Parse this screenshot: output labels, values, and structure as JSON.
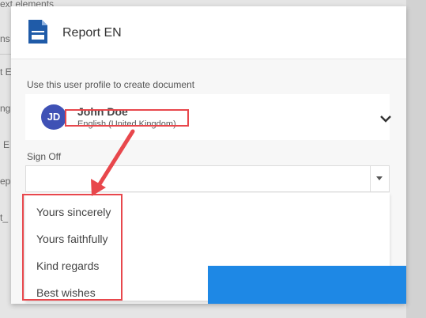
{
  "background": {
    "fragments": [
      "ext elements",
      "ns",
      "t E",
      "ng",
      "E",
      "ep",
      "t_"
    ]
  },
  "dialog": {
    "title": "Report EN",
    "icon": "document-icon",
    "profile_label": "Use this user profile to create document",
    "profile": {
      "initials": "JD",
      "name": "John Doe",
      "language": "English (United Kingdom)",
      "avatar_color": "#3f51b5"
    },
    "signoff_label": "Sign Off",
    "signoff_value": "",
    "signoff_options": [
      "Yours sincerely",
      "Yours faithfully",
      "Kind regards",
      "Best wishes"
    ]
  },
  "colors": {
    "accent": "#1e88e5",
    "annotation": "#e8474c"
  }
}
